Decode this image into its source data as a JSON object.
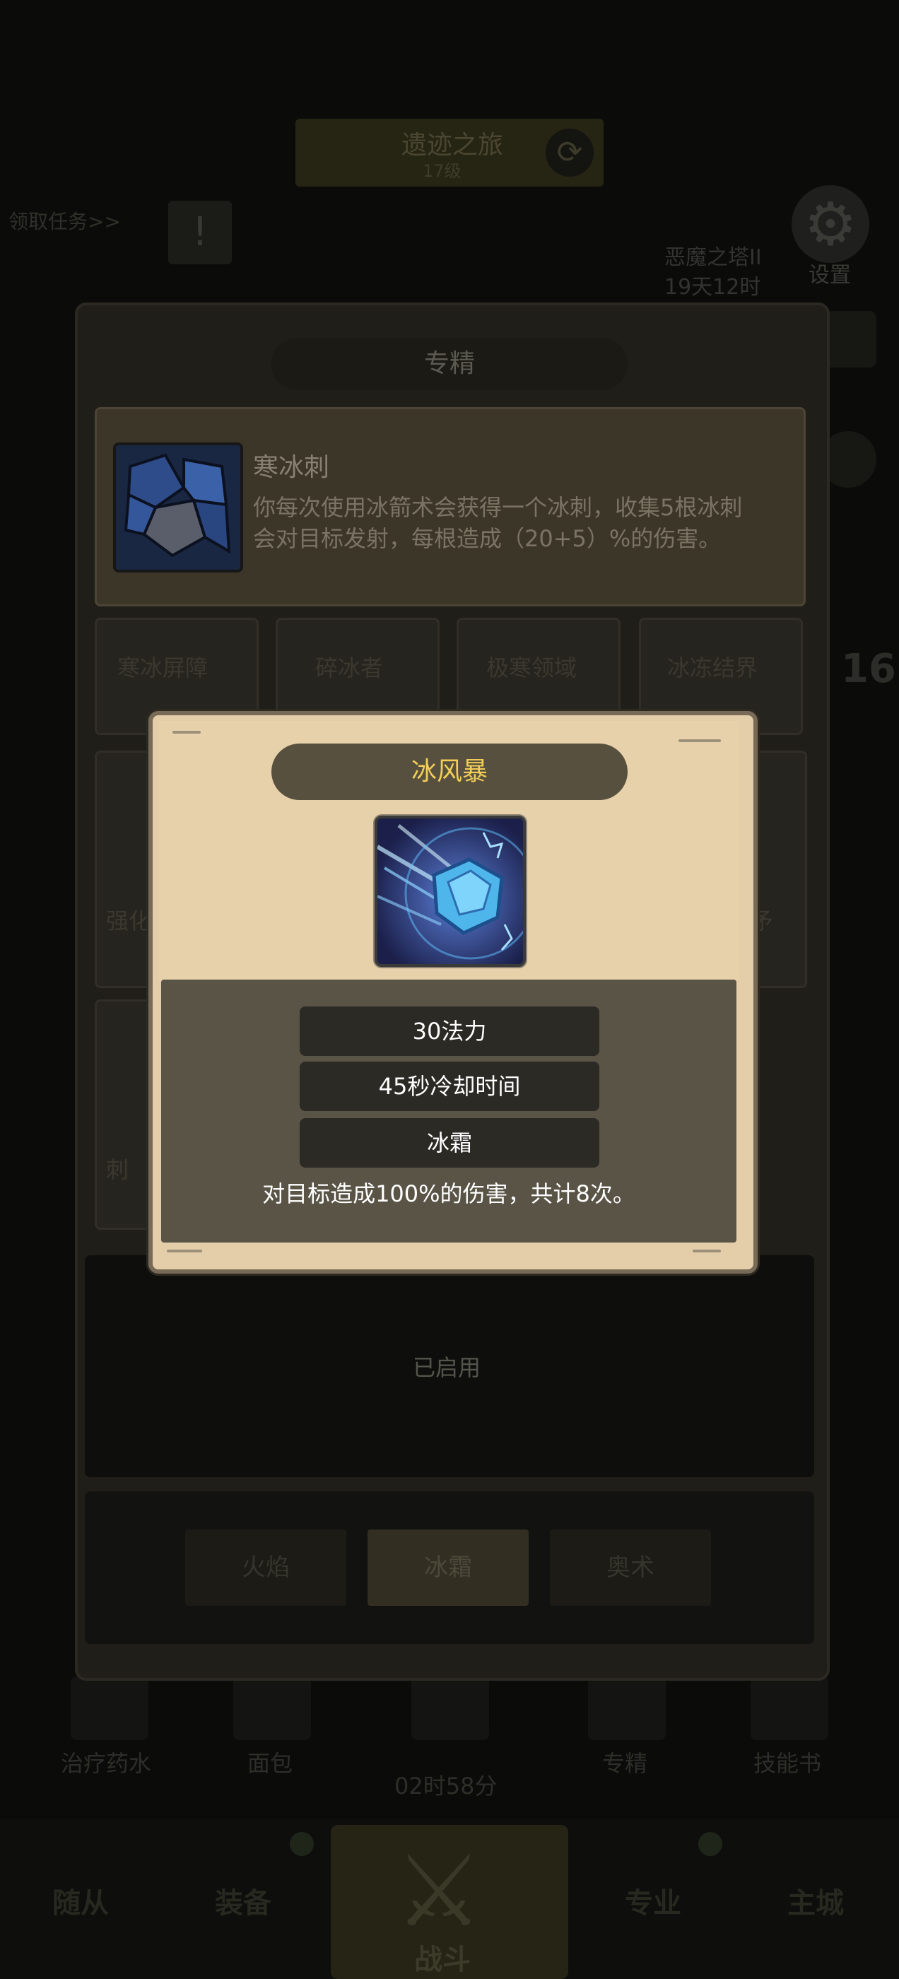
{
  "background": {
    "top_banner": {
      "title": "遗迹之旅",
      "subtitle": "17级"
    },
    "quest_link": "领取任务>>",
    "alert_icon": "!",
    "event": {
      "name": "恶魔之塔II",
      "timer": "19天12时"
    },
    "settings_label": "设置",
    "side_number": "16",
    "quick_actions": [
      {
        "label": "治疗药水"
      },
      {
        "label": "面包"
      },
      {
        "label": "02时58分"
      },
      {
        "label": "专精"
      },
      {
        "label": "技能书"
      }
    ],
    "nav": {
      "left1": "随从",
      "left2": "装备",
      "center": "战斗",
      "right1": "专业",
      "right2": "主城"
    }
  },
  "panel": {
    "title": "专精",
    "passive": {
      "name": "寒冰刺",
      "description": "你每次使用冰箭术会获得一个冰刺，收集5根冰刺会对目标发射，每根造成（20+5）%的伤害。"
    },
    "grid_labels": {
      "row1": [
        "寒冰屏障",
        "碎冰者",
        "极寒领域",
        "冰冻结界"
      ],
      "row2_left": "强化",
      "row2_right": "矛",
      "row3_left": "刺"
    },
    "status": "已启用",
    "tabs": [
      "火焰",
      "冰霜",
      "奥术"
    ],
    "active_tab": "冰霜"
  },
  "popup": {
    "title": "冰风暴",
    "icon": "frost-storm-icon",
    "stats": [
      "30法力",
      "45秒冷却时间",
      "冰霜"
    ],
    "description": "对目标造成100%的伤害，共计8次。"
  },
  "colors": {
    "popup_title_text": "#f2cd58",
    "popup_parchment": "#e4ceaa",
    "popup_body": "#5a5447",
    "stat_pill": "#2c2a24"
  }
}
